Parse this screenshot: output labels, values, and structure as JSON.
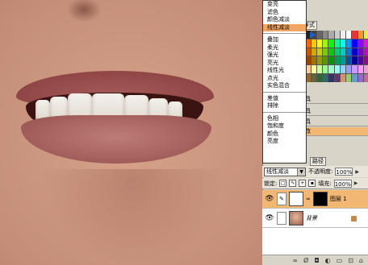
{
  "blend_menu": {
    "items": [
      {
        "label": "变亮"
      },
      {
        "label": "滤色"
      },
      {
        "label": "颜色减淡"
      },
      {
        "label": "线性减淡",
        "selected": true
      },
      {
        "sep": true
      },
      {
        "label": "叠加"
      },
      {
        "label": "柔光"
      },
      {
        "label": "强光"
      },
      {
        "label": "亮光"
      },
      {
        "label": "线性光"
      },
      {
        "label": "点光"
      },
      {
        "label": "实色混合"
      },
      {
        "sep": true
      },
      {
        "label": "差值"
      },
      {
        "label": "排除"
      },
      {
        "sep": true
      },
      {
        "label": "色相"
      },
      {
        "label": "饱和度"
      },
      {
        "label": "颜色"
      },
      {
        "label": "亮度"
      }
    ]
  },
  "background_panels": {
    "tab1": "样式",
    "tab2": "路径",
    "layer_strips": [
      "具",
      "具",
      "具",
      "改"
    ]
  },
  "layers_panel": {
    "blend_mode": "线性减淡",
    "opacity_label": "不透明度:",
    "opacity_value": "100%",
    "lock_label": "锁定:",
    "fill_label": "填充:",
    "fill_value": "100%",
    "layers": [
      {
        "name": "图层 1",
        "active": true
      },
      {
        "name": "背景",
        "active": false,
        "locked": true
      }
    ]
  },
  "colors": {
    "selection": "#f2a663",
    "active_layer": "#f3b774",
    "panel_bg": "#d9d4c8"
  },
  "icons": [
    "eye-icon",
    "brush-icon",
    "chain-icon",
    "lock-icon",
    "link-icon",
    "fx-icon",
    "mask-icon",
    "adjustment-icon",
    "folder-icon",
    "new-layer-icon",
    "trash-icon",
    "cursor-arrow-icon"
  ]
}
